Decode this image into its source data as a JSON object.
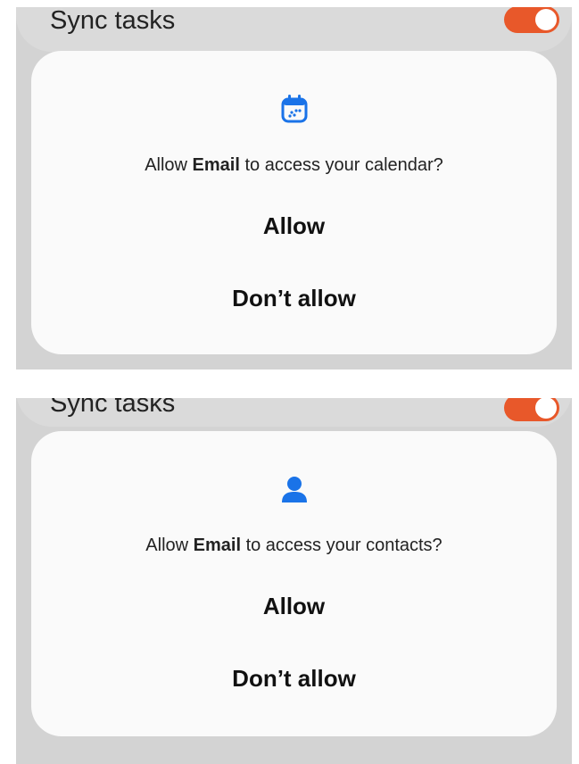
{
  "screens": [
    {
      "sync_label": "Sync tasks",
      "permission_icon": "calendar-icon",
      "prompt_prefix": "Allow ",
      "app_name": "Email",
      "prompt_suffix": " to access your calendar?",
      "allow_label": "Allow",
      "deny_label": "Don’t allow"
    },
    {
      "sync_label": "Sync tasks",
      "permission_icon": "person-icon",
      "prompt_prefix": "Allow ",
      "app_name": "Email",
      "prompt_suffix": " to access your contacts?",
      "allow_label": "Allow",
      "deny_label": "Don’t allow"
    }
  ],
  "colors": {
    "accent_blue": "#1a73e8",
    "toggle_on": "#e8582a",
    "scrim": "#d3d3d3",
    "dialog_bg": "#fafafa"
  }
}
